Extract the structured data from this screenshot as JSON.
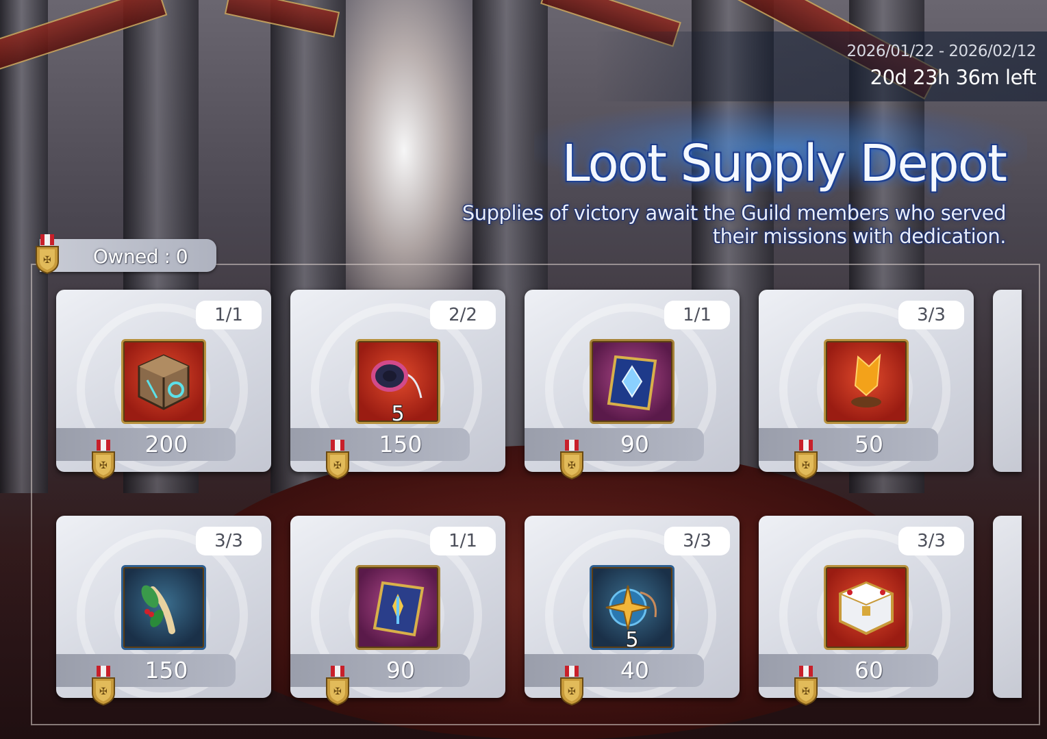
{
  "event": {
    "date_range": "2026/01/22 - 2026/02/12",
    "time_left": "20d 23h 36m left",
    "title": "Loot Supply Depot",
    "subtitle": "Supplies of victory await the Guild members who served their missions with dedication."
  },
  "currency": {
    "owned_label": "Owned : 0",
    "icon": "guild-medal-icon"
  },
  "colors": {
    "card_bg": "#d5d8e1",
    "price_bar": "#9a9eab",
    "title_glow": "#2a6ae0",
    "item_frame_gold": "#b8923e"
  },
  "items": [
    {
      "limit": "1/1",
      "icon": "treasure-cube-icon",
      "quantity": "",
      "price": "200",
      "frame": "red"
    },
    {
      "limit": "2/2",
      "icon": "pendant-necklace-icon",
      "quantity": "5",
      "price": "150",
      "frame": "red"
    },
    {
      "limit": "1/1",
      "icon": "crystal-tome-icon",
      "quantity": "",
      "price": "90",
      "frame": "purple"
    },
    {
      "limit": "3/3",
      "icon": "flame-crystal-icon",
      "quantity": "",
      "price": "50",
      "frame": "red"
    },
    {
      "limit": "3/3",
      "icon": "ginseng-root-icon",
      "quantity": "",
      "price": "150",
      "frame": "blue"
    },
    {
      "limit": "1/1",
      "icon": "ornate-book-icon",
      "quantity": "",
      "price": "90",
      "frame": "purple"
    },
    {
      "limit": "3/3",
      "icon": "star-amulet-icon",
      "quantity": "5",
      "price": "40",
      "frame": "blue"
    },
    {
      "limit": "3/3",
      "icon": "white-chest-icon",
      "quantity": "",
      "price": "60",
      "frame": "red"
    }
  ]
}
